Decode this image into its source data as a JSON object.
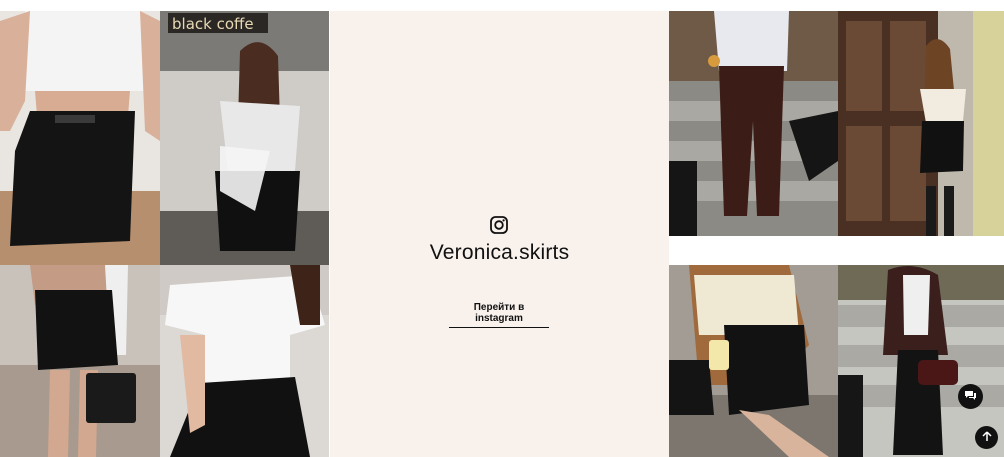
{
  "profile": {
    "name": "Veronica.skirts",
    "cta_label": "Перейти в instagram",
    "icon": "instagram-icon"
  },
  "photos": [
    {
      "sign": "black coffe"
    }
  ],
  "widgets": {
    "chat_icon": "chat-icon",
    "scroll_top_icon": "arrow-up-icon"
  },
  "colors": {
    "panel_bg": "#f8f1ec",
    "text": "#111111",
    "fab_bg": "#111111"
  }
}
